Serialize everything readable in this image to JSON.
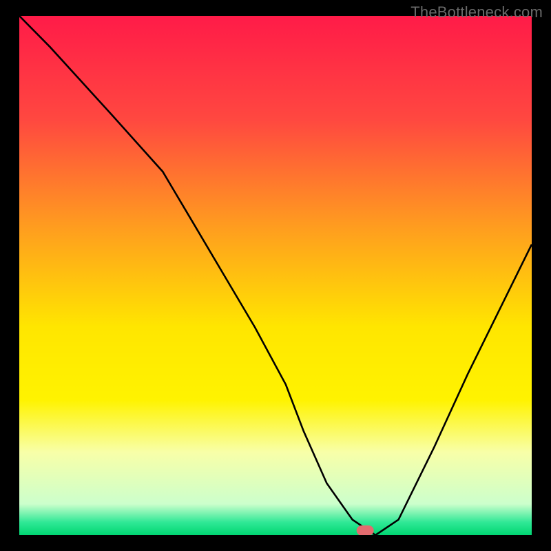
{
  "attribution": "TheBottleneck.com",
  "chart_data": {
    "type": "line",
    "title": "",
    "xlabel": "",
    "ylabel": "",
    "x_range": [
      0,
      1
    ],
    "y_range": [
      0,
      1
    ],
    "series": [
      {
        "name": "bottleneck-curve",
        "x": [
          0.0,
          0.06,
          0.12,
          0.18,
          0.23,
          0.28,
          0.34,
          0.4,
          0.46,
          0.52,
          0.555,
          0.6,
          0.65,
          0.695,
          0.74,
          0.81,
          0.875,
          0.94,
          1.0
        ],
        "y": [
          1.0,
          0.94,
          0.875,
          0.81,
          0.755,
          0.7,
          0.6,
          0.5,
          0.4,
          0.29,
          0.2,
          0.1,
          0.03,
          0.0,
          0.03,
          0.17,
          0.31,
          0.44,
          0.56
        ]
      }
    ],
    "annotations": [
      {
        "name": "optimum-marker",
        "x": 0.675,
        "y": 0.005,
        "shape": "pill",
        "color": "#e36b6f"
      }
    ],
    "gradient_bands": [
      {
        "stop": 0.0,
        "color": "#ff1b48"
      },
      {
        "stop": 0.2,
        "color": "#ff4840"
      },
      {
        "stop": 0.4,
        "color": "#ff9a20"
      },
      {
        "stop": 0.6,
        "color": "#ffe600"
      },
      {
        "stop": 0.74,
        "color": "#fff300"
      },
      {
        "stop": 0.84,
        "color": "#f8ffa8"
      },
      {
        "stop": 0.94,
        "color": "#ccffcc"
      },
      {
        "stop": 0.975,
        "color": "#30e896"
      },
      {
        "stop": 1.0,
        "color": "#00d672"
      }
    ]
  }
}
